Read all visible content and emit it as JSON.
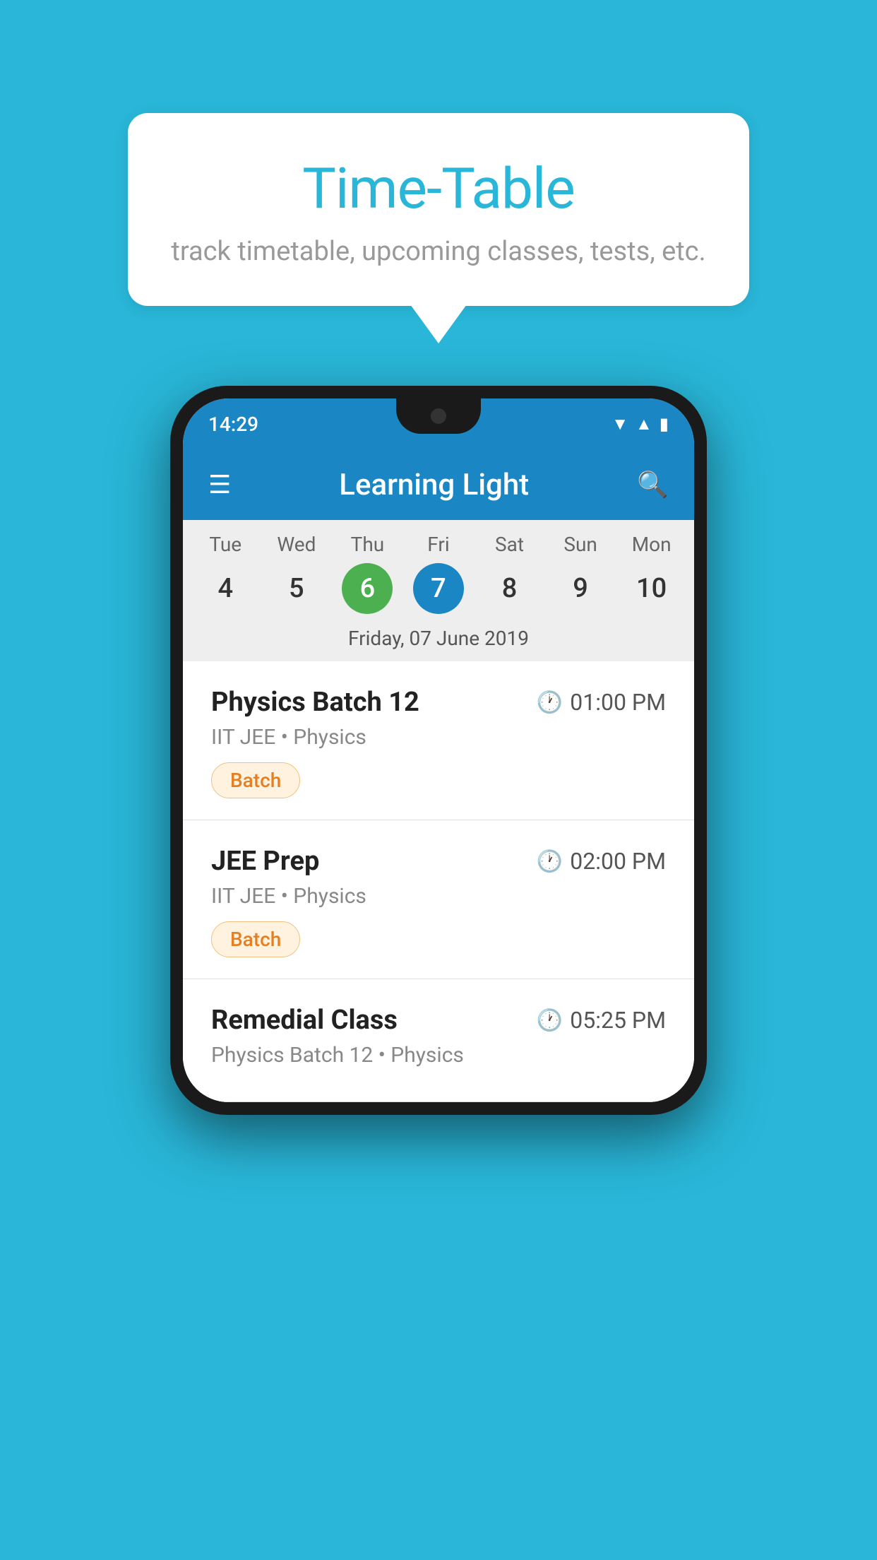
{
  "background_color": "#29b6d8",
  "speech_bubble": {
    "title": "Time-Table",
    "subtitle": "track timetable, upcoming classes, tests, etc."
  },
  "status_bar": {
    "time": "14:29"
  },
  "app_bar": {
    "title": "Learning Light"
  },
  "calendar": {
    "days": [
      {
        "label": "Tue",
        "number": "4",
        "state": "normal"
      },
      {
        "label": "Wed",
        "number": "5",
        "state": "normal"
      },
      {
        "label": "Thu",
        "number": "6",
        "state": "today"
      },
      {
        "label": "Fri",
        "number": "7",
        "state": "selected"
      },
      {
        "label": "Sat",
        "number": "8",
        "state": "normal"
      },
      {
        "label": "Sun",
        "number": "9",
        "state": "normal"
      },
      {
        "label": "Mon",
        "number": "10",
        "state": "normal"
      }
    ],
    "selected_date_label": "Friday, 07 June 2019"
  },
  "classes": [
    {
      "name": "Physics Batch 12",
      "time": "01:00 PM",
      "subject": "IIT JEE • Physics",
      "tag": "Batch"
    },
    {
      "name": "JEE Prep",
      "time": "02:00 PM",
      "subject": "IIT JEE • Physics",
      "tag": "Batch"
    },
    {
      "name": "Remedial Class",
      "time": "05:25 PM",
      "subject": "Physics Batch 12 • Physics",
      "tag": ""
    }
  ]
}
